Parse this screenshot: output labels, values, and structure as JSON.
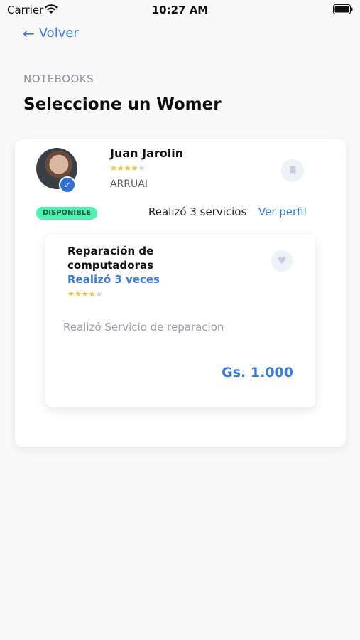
{
  "status_bar": {
    "carrier": "Carrier",
    "time": "10:27 AM"
  },
  "nav": {
    "back_label": "Volver"
  },
  "header": {
    "section": "NOTEBOOKS",
    "title": "Seleccione un Womer"
  },
  "provider": {
    "name": "Juan Jarolin",
    "location": "ARRUAI",
    "rating": 4,
    "rating_max": 5,
    "status": "DISPONIBLE",
    "services_done": "Realizó 3 servicios",
    "profile_link": "Ver perfil"
  },
  "service": {
    "name": "Reparación de computadoras",
    "times": "Realizó 3 veces",
    "rating": 4,
    "rating_max": 5,
    "description": "Realizó Servicio de reparacion",
    "price": "Gs. 1.000"
  },
  "colors": {
    "accent": "#3a7be0",
    "badge_bg": "#4ff0b0",
    "star": "#f2c531"
  }
}
